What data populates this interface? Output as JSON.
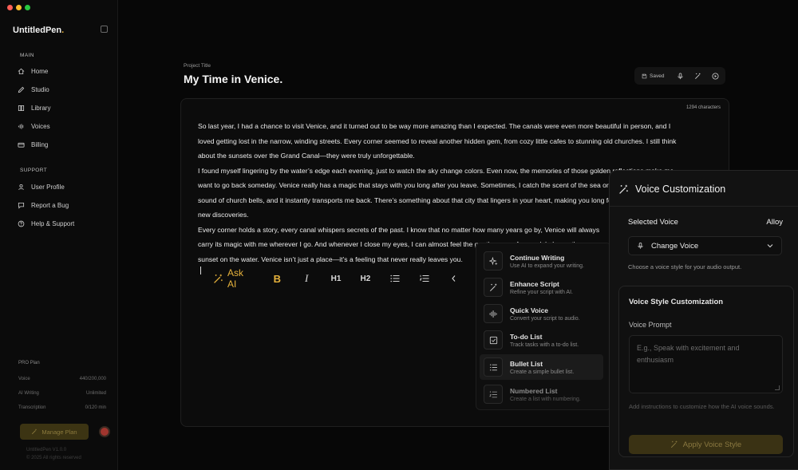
{
  "window": {
    "traffic_lights": [
      "#ff5f57",
      "#febc2e",
      "#28c840"
    ]
  },
  "brand": {
    "name": "UntitledPen",
    "dot": ".",
    "accent_color": "#e6b23c"
  },
  "sidebar": {
    "main_label": "MAIN",
    "main_items": [
      {
        "label": "Home",
        "icon": "home-icon"
      },
      {
        "label": "Studio",
        "icon": "pen-icon"
      },
      {
        "label": "Library",
        "icon": "book-icon"
      },
      {
        "label": "Voices",
        "icon": "waveform-icon"
      },
      {
        "label": "Billing",
        "icon": "card-icon"
      }
    ],
    "support_label": "SUPPORT",
    "support_items": [
      {
        "label": "User Profile",
        "icon": "user-icon"
      },
      {
        "label": "Report a Bug",
        "icon": "chat-icon"
      },
      {
        "label": "Help & Support",
        "icon": "help-icon"
      }
    ],
    "plan": {
      "title": "PRO Plan",
      "rows": [
        {
          "label": "Voice",
          "value": "440/200,000"
        },
        {
          "label": "AI Writing",
          "value": "Unlimited"
        },
        {
          "label": "Transcription",
          "value": "0/120 min"
        }
      ]
    },
    "manage_button": "Manage Plan",
    "version": "UntitledPen V1.0.0",
    "copyright": "© 2025 All rights reserved"
  },
  "project": {
    "label": "Project Title",
    "title": "My Time in Venice.",
    "saved_label": "Saved"
  },
  "editor": {
    "char_count": "1294 characters",
    "lines": [
      "So last year, I had a chance to visit Venice, and it turned out to be way more amazing than I expected.  The canals were even more beautiful in person, and I",
      "loved getting lost in the narrow, winding streets. Every corner seemed to reveal another hidden gem, from cozy little cafes to stunning old churches. I still think",
      "about the sunsets over the Grand Canal—they were truly unforgettable.",
      " I found myself lingering by the water’s edge each evening, just to watch the sky change colors. Even now, the memories of those golden reflections make me",
      "want to go back someday. Venice really has a magic that stays with you long after you leave.  Sometimes, I catch the scent of the sea or hear the distant",
      "sound of church bells, and it instantly transports me back. There’s something about that city that lingers in your heart, making you long for more",
      "new discoveries.",
      "Every corner holds a story, every canal whispers secrets of the past. I know that no matter how many years go by, Venice will always",
      "carry its magic with me wherever I go.  And whenever I close my eyes, I can almost feel the gentle sway of a gondola beneath me",
      "sunset on the water. Venice isn’t just a place—it’s a feeling that never really leaves you."
    ]
  },
  "toolbar": {
    "ask_ai": "Ask AI",
    "bold": "B",
    "italic": "I",
    "h1": "H1",
    "h2": "H2"
  },
  "ai_menu": [
    {
      "title": "Continue Writing",
      "desc": "Use AI to expand your writing.",
      "icon": "sparkle-icon"
    },
    {
      "title": "Enhance Script",
      "desc": "Refine your script with AI.",
      "icon": "wand-icon"
    },
    {
      "title": "Quick Voice",
      "desc": "Convert your script to audio.",
      "icon": "audio-wave-icon"
    },
    {
      "title": "To-do List",
      "desc": "Track tasks with a to-do list.",
      "icon": "checkbox-icon"
    },
    {
      "title": "Bullet List",
      "desc": "Create a simple bullet list.",
      "icon": "bullet-list-icon"
    },
    {
      "title": "Numbered List",
      "desc": "Create a list with numbering.",
      "icon": "numbered-list-icon"
    }
  ],
  "voice_panel": {
    "title": "Voice Customization",
    "selected_label": "Selected Voice",
    "selected_value": "Alloy",
    "change_voice": "Change Voice",
    "hint": "Choose a voice style for your audio output.",
    "style_title": "Voice Style Customization",
    "prompt_label": "Voice Prompt",
    "prompt_placeholder": "E.g., Speak with excitement and enthusiasm",
    "prompt_hint": "Add instructions to customize how the AI voice sounds.",
    "apply_button": "Apply Voice Style"
  }
}
